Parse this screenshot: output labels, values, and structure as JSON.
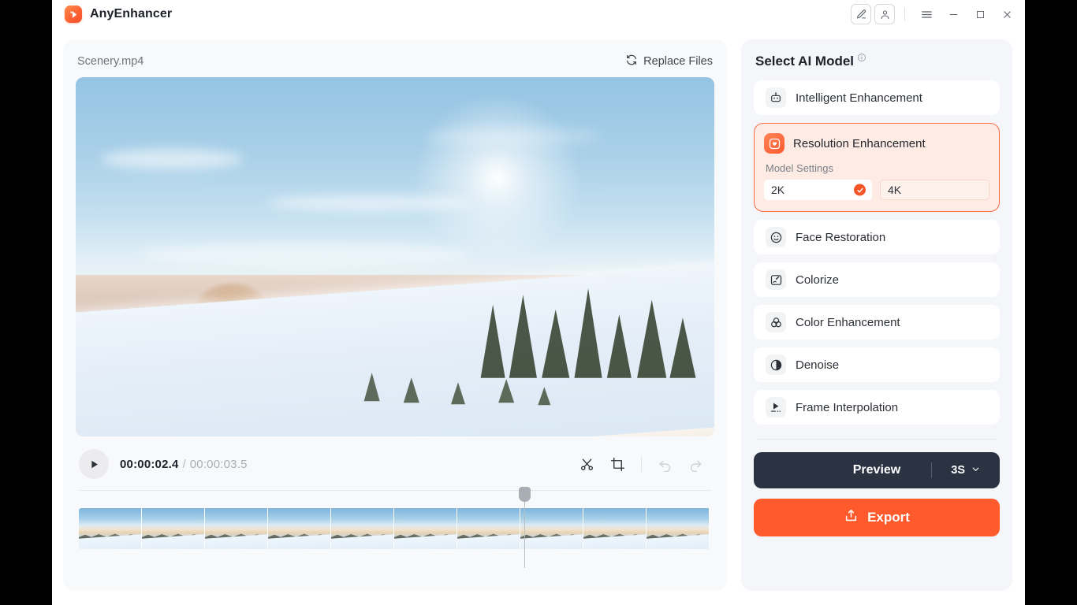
{
  "app": {
    "title": "AnyEnhancer",
    "logo_icon": "anyenhancer-logo-icon"
  },
  "titlebar": {
    "edit_icon": "pen-edit-icon",
    "account_icon": "user-account-icon",
    "menu_icon": "hamburger-menu-icon",
    "minimize_icon": "minimize-icon",
    "maximize_icon": "maximize-icon",
    "close_icon": "close-icon"
  },
  "editor": {
    "file_name": "Scenery.mp4",
    "replace_files_label": "Replace Files",
    "replace_files_icon": "refresh-swap-icon",
    "preview_alt": "Winter mountain scenery video preview",
    "transport": {
      "play_icon": "play-icon",
      "current_time": "00:00:02.4",
      "time_separator": "/",
      "total_time": "00:00:03.5",
      "cut_icon": "scissors-cut-icon",
      "crop_icon": "crop-icon",
      "undo_icon": "undo-icon",
      "redo_icon": "redo-icon"
    },
    "timeline": {
      "playhead_icon": "playhead-handle-icon",
      "frame_count": 10
    }
  },
  "sidebar": {
    "title": "Select AI Model",
    "info_icon": "info-icon",
    "models": [
      {
        "label": "Intelligent Enhancement",
        "icon": "robot-icon",
        "selected": false
      },
      {
        "label": "Resolution Enhancement",
        "icon": "resolution-icon",
        "selected": true
      },
      {
        "label": "Face Restoration",
        "icon": "smiley-face-icon",
        "selected": false
      },
      {
        "label": "Colorize",
        "icon": "colorize-brush-icon",
        "selected": false
      },
      {
        "label": "Color Enhancement",
        "icon": "color-circles-icon",
        "selected": false
      },
      {
        "label": "Denoise",
        "icon": "contrast-circle-icon",
        "selected": false
      },
      {
        "label": "Frame Interpolation",
        "icon": "frame-play-icon",
        "selected": false
      }
    ],
    "model_settings": {
      "label": "Model Settings",
      "options": [
        {
          "label": "2K",
          "selected": true
        },
        {
          "label": "4K",
          "selected": false
        }
      ],
      "check_icon": "check-circle-icon"
    },
    "actions": {
      "preview_label": "Preview",
      "preview_duration": "3S",
      "preview_chevron_icon": "chevron-down-icon",
      "export_label": "Export",
      "export_icon": "upload-export-icon"
    }
  },
  "colors": {
    "accent_orange": "#ff5a2c",
    "selected_card_bg": "#fdebe4",
    "selected_card_border": "#ff6b3d",
    "preview_button_bg": "#2b3242",
    "sidebar_bg": "#f4f6fa",
    "editor_bg": "#f8f9fb"
  }
}
